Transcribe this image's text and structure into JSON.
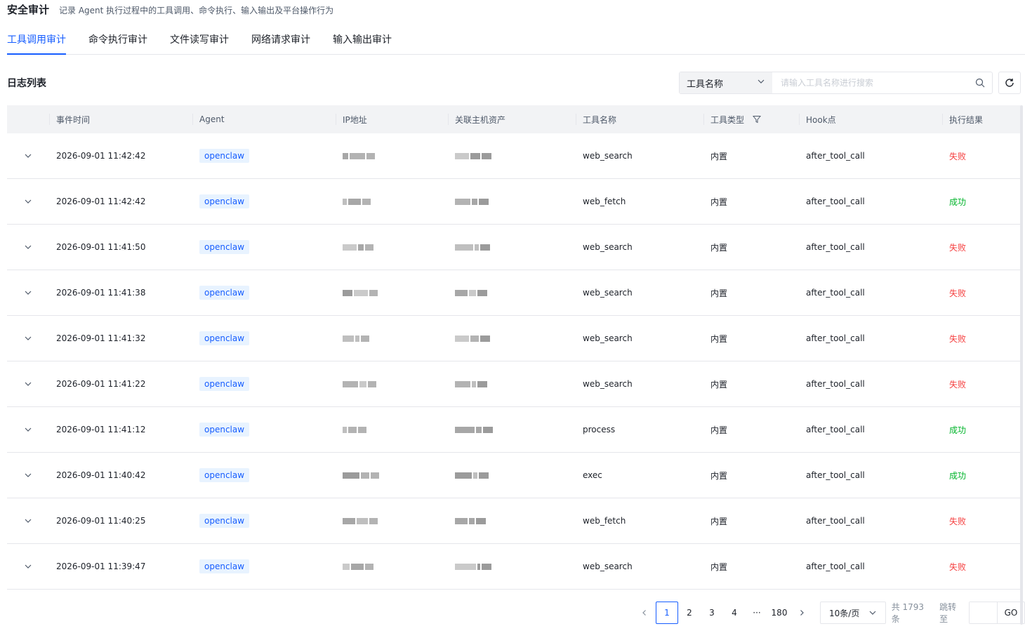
{
  "header": {
    "title": "安全审计",
    "subtitle": "记录 Agent 执行过程中的工具调用、命令执行、输入输出及平台操作行为"
  },
  "tabs": [
    "工具调用审计",
    "命令执行审计",
    "文件读写审计",
    "网络请求审计",
    "输入输出审计"
  ],
  "active_tab": 0,
  "section_title": "日志列表",
  "search": {
    "field": "工具名称",
    "placeholder": "请输入工具名称进行搜索"
  },
  "columns": [
    "事件时间",
    "Agent",
    "IP地址",
    "关联主机资产",
    "工具名称",
    "工具类型",
    "Hook点",
    "执行结果"
  ],
  "rows": [
    {
      "time": "2026-09-01 11:42:42",
      "agent": "openclaw",
      "tool": "web_search",
      "type": "内置",
      "hook": "after_tool_call",
      "result": "失败",
      "status": "fail"
    },
    {
      "time": "2026-09-01 11:42:42",
      "agent": "openclaw",
      "tool": "web_fetch",
      "type": "内置",
      "hook": "after_tool_call",
      "result": "成功",
      "status": "success"
    },
    {
      "time": "2026-09-01 11:41:50",
      "agent": "openclaw",
      "tool": "web_search",
      "type": "内置",
      "hook": "after_tool_call",
      "result": "失败",
      "status": "fail"
    },
    {
      "time": "2026-09-01 11:41:38",
      "agent": "openclaw",
      "tool": "web_search",
      "type": "内置",
      "hook": "after_tool_call",
      "result": "失败",
      "status": "fail"
    },
    {
      "time": "2026-09-01 11:41:32",
      "agent": "openclaw",
      "tool": "web_search",
      "type": "内置",
      "hook": "after_tool_call",
      "result": "失败",
      "status": "fail"
    },
    {
      "time": "2026-09-01 11:41:22",
      "agent": "openclaw",
      "tool": "web_search",
      "type": "内置",
      "hook": "after_tool_call",
      "result": "失败",
      "status": "fail"
    },
    {
      "time": "2026-09-01 11:41:12",
      "agent": "openclaw",
      "tool": "process",
      "type": "内置",
      "hook": "after_tool_call",
      "result": "成功",
      "status": "success"
    },
    {
      "time": "2026-09-01 11:40:42",
      "agent": "openclaw",
      "tool": "exec",
      "type": "内置",
      "hook": "after_tool_call",
      "result": "成功",
      "status": "success"
    },
    {
      "time": "2026-09-01 11:40:25",
      "agent": "openclaw",
      "tool": "web_fetch",
      "type": "内置",
      "hook": "after_tool_call",
      "result": "失败",
      "status": "fail"
    },
    {
      "time": "2026-09-01 11:39:47",
      "agent": "openclaw",
      "tool": "web_search",
      "type": "内置",
      "hook": "after_tool_call",
      "result": "失败",
      "status": "fail"
    }
  ],
  "pagination": {
    "pages": [
      "1",
      "2",
      "3",
      "4",
      "···",
      "180"
    ],
    "current": "1",
    "page_size": "10条/页",
    "total": "共 1793 条",
    "jump_label": "跳转至",
    "go": "GO"
  },
  "colors": {
    "primary": "#165dff",
    "fail": "#f53f3f",
    "success": "#00b42a"
  }
}
